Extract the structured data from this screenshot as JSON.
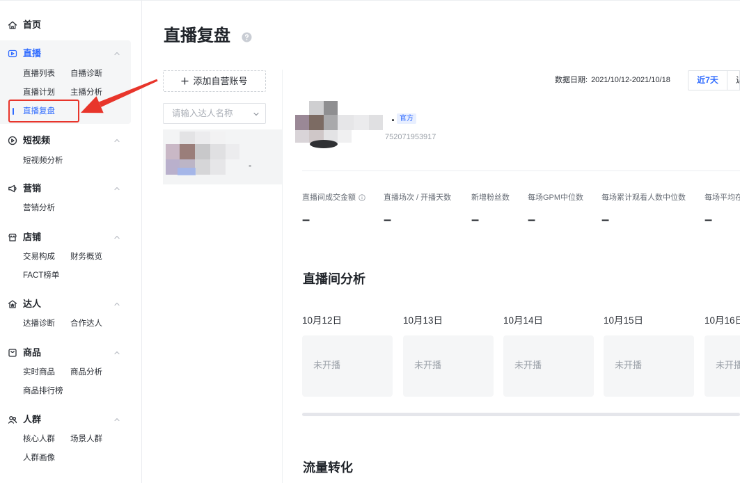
{
  "colors": {
    "accent": "#2f6bff",
    "annotation": "#e8352b",
    "card_bg": "#f5f6f7",
    "text_muted": "#9aa0a8"
  },
  "sidebar": {
    "home": {
      "label": "首页",
      "icon": "home-icon"
    },
    "sections": [
      {
        "label": "直播",
        "icon": "live-icon",
        "expanded": true,
        "rows": [
          [
            "直播列表",
            "自播诊断"
          ],
          [
            "直播计划",
            "主播分析"
          ],
          [
            "直播复盘"
          ]
        ]
      },
      {
        "label": "短视频",
        "icon": "short-video-icon",
        "expanded": true,
        "rows": [
          [
            "短视频分析"
          ]
        ]
      },
      {
        "label": "营销",
        "icon": "marketing-icon",
        "expanded": true,
        "rows": [
          [
            "营销分析"
          ]
        ]
      },
      {
        "label": "店铺",
        "icon": "store-icon",
        "expanded": true,
        "rows": [
          [
            "交易构成",
            "财务概览"
          ],
          [
            "FACT榜单"
          ]
        ]
      },
      {
        "label": "达人",
        "icon": "influencer-icon",
        "expanded": true,
        "rows": [
          [
            "达播诊断",
            "合作达人"
          ]
        ]
      },
      {
        "label": "商品",
        "icon": "product-icon",
        "expanded": true,
        "rows": [
          [
            "实时商品",
            "商品分析"
          ],
          [
            "商品排行榜"
          ]
        ]
      },
      {
        "label": "人群",
        "icon": "crowd-icon",
        "expanded": true,
        "rows": [
          [
            "核心人群",
            "场景人群"
          ],
          [
            "人群画像"
          ]
        ]
      }
    ]
  },
  "page": {
    "title": "直播复盘",
    "help_icon": "question-circle-icon"
  },
  "account_panel": {
    "add_button": {
      "label": "添加自营账号",
      "icon": "plus-icon"
    },
    "search_placeholder": "请输入达人名称",
    "search_icon": "chevron-down-icon",
    "accounts": [
      {
        "name": "-",
        "selected": true
      }
    ]
  },
  "toolbar": {
    "date_label": "数据日期:",
    "date_range": "2021/10/12-2021/10/18",
    "periods": [
      {
        "label": "近7天",
        "selected": true
      },
      {
        "label": "近",
        "selected": false
      }
    ]
  },
  "profile": {
    "name": ".",
    "tag": "官方",
    "id": "752071953917"
  },
  "metrics": [
    {
      "label": "直播间成交金额",
      "value": "–",
      "info_icon": "info-circle-icon"
    },
    {
      "label": "直播场次 / 开播天数",
      "value": "–"
    },
    {
      "label": "新增粉丝数",
      "value": "–"
    },
    {
      "label": "每场GPM中位数",
      "value": "–"
    },
    {
      "label": "每场累计观看人数中位数",
      "value": "–"
    },
    {
      "label": "每场平均在",
      "value": "–"
    }
  ],
  "live_room_analysis": {
    "title": "直播间分析",
    "days": [
      {
        "date": "10月12日",
        "status": "未开播"
      },
      {
        "date": "10月13日",
        "status": "未开播"
      },
      {
        "date": "10月14日",
        "status": "未开播"
      },
      {
        "date": "10月15日",
        "status": "未开播"
      },
      {
        "date": "10月16日",
        "status": "未开播"
      }
    ]
  },
  "traffic_conversion": {
    "title": "流量转化"
  }
}
